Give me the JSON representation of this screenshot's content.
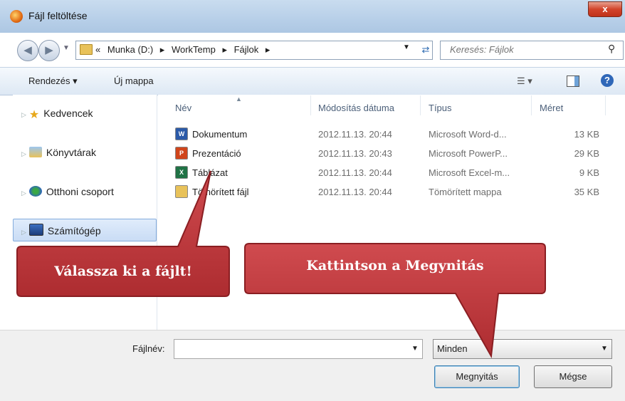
{
  "window": {
    "title": "Fájl feltöltése",
    "close_label": "x"
  },
  "address": {
    "parts": [
      "«",
      "Munka (D:)",
      "▸",
      "WorkTemp",
      "▸",
      "Fájlok",
      "▸"
    ],
    "search_placeholder": "Keresés: Fájlok"
  },
  "toolbar": {
    "organize": "Rendezés ▾",
    "new_folder": "Új mappa"
  },
  "sidebar": {
    "items": [
      {
        "label": "Kedvencek",
        "icon": "star-icon"
      },
      {
        "label": "Könyvtárak",
        "icon": "library-icon"
      },
      {
        "label": "Otthoni csoport",
        "icon": "homegroup-icon"
      },
      {
        "label": "Számítógép",
        "icon": "computer-icon",
        "selected": true
      }
    ]
  },
  "columns": {
    "name": "Név",
    "date": "Módosítás dátuma",
    "type": "Típus",
    "size": "Méret"
  },
  "files": [
    {
      "name": "Dokumentum",
      "date": "2012.11.13. 20:44",
      "type": "Microsoft Word-d...",
      "size": "13 KB",
      "icon": "word-icon",
      "color": "#2b5aa8"
    },
    {
      "name": "Prezentáció",
      "date": "2012.11.13. 20:43",
      "type": "Microsoft PowerP...",
      "size": "29 KB",
      "icon": "powerpoint-icon",
      "color": "#d0451b"
    },
    {
      "name": "Táblázat",
      "date": "2012.11.13. 20:44",
      "type": "Microsoft Excel-m...",
      "size": "9 KB",
      "icon": "excel-icon",
      "color": "#207245"
    },
    {
      "name": "Tömörített fájl",
      "date": "2012.11.13. 20:44",
      "type": "Tömörített mappa",
      "size": "35 KB",
      "icon": "zip-icon",
      "color": "#e8c25a"
    }
  ],
  "bottom": {
    "filename_label": "Fájlnév:",
    "filename_value": "",
    "filter_text": "Minden",
    "open_button": "Megnyitás",
    "cancel_button": "Mégse"
  },
  "callouts": {
    "select_file": "Válassza ki a fájlt!",
    "click_open": "Kattintson a Megynitás"
  },
  "colors": {
    "callout": "#c0393d",
    "callout_border": "#8a1e22",
    "accent": "#2f67b8"
  }
}
